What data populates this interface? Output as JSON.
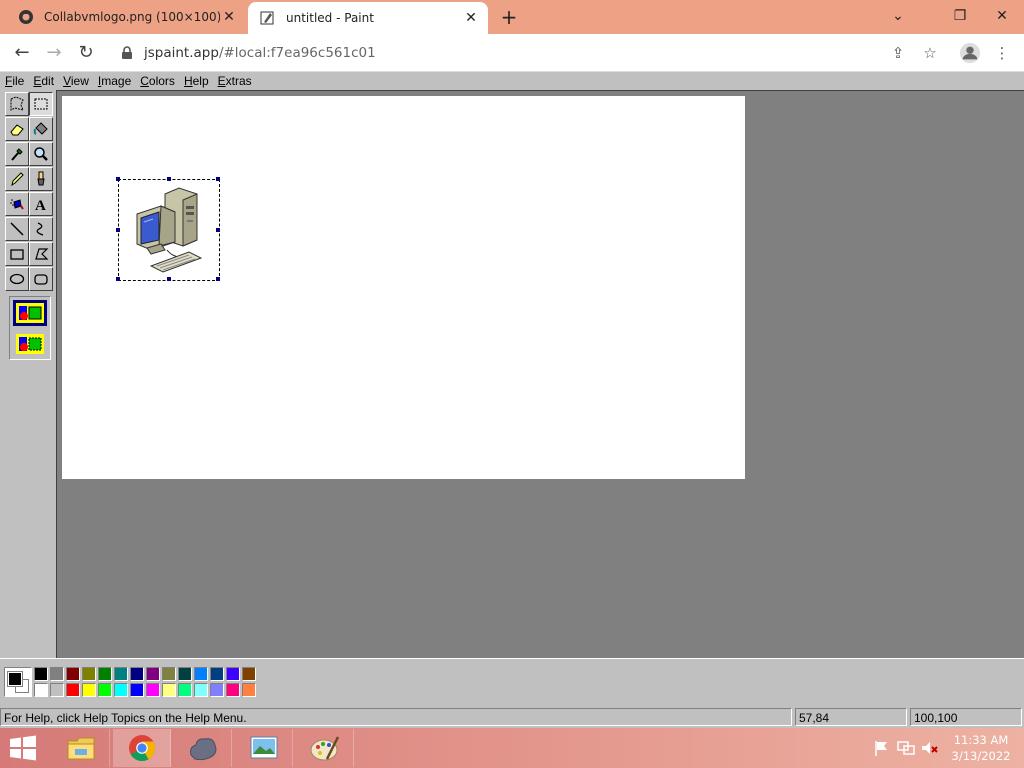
{
  "browser": {
    "tabs": [
      {
        "title": "Collabvmlogo.png (100×100)",
        "icon": "image-tab-icon",
        "active": false
      },
      {
        "title": "untitled - Paint",
        "icon": "paint-tab-icon",
        "active": true
      }
    ],
    "address": {
      "domain": "jspaint.app",
      "path": "/#local:f7ea96c561c01"
    }
  },
  "paint": {
    "menus": [
      {
        "label": "File",
        "accel": "F",
        "rest": "ile"
      },
      {
        "label": "Edit",
        "accel": "E",
        "rest": "dit"
      },
      {
        "label": "View",
        "accel": "V",
        "rest": "iew"
      },
      {
        "label": "Image",
        "accel": "I",
        "rest": "mage"
      },
      {
        "label": "Colors",
        "accel": "C",
        "rest": "olors"
      },
      {
        "label": "Help",
        "accel": "H",
        "rest": "elp"
      },
      {
        "label": "Extras",
        "accel": "E",
        "rest": "xtras"
      }
    ],
    "tools": [
      "free-form-select-icon",
      "select-icon",
      "eraser-icon",
      "fill-bucket-icon",
      "pick-color-icon",
      "magnifier-icon",
      "pencil-icon",
      "brush-icon",
      "airbrush-icon",
      "text-icon",
      "line-icon",
      "curve-icon",
      "rectangle-icon",
      "polygon-icon",
      "ellipse-icon",
      "rounded-rectangle-icon"
    ],
    "selected_tool": "select-icon",
    "palette": {
      "primary": "#000000",
      "secondary": "#ffffff",
      "row1": [
        "#000000",
        "#808080",
        "#800000",
        "#808000",
        "#008000",
        "#008080",
        "#000080",
        "#800080",
        "#808040",
        "#004040",
        "#0080ff",
        "#004080",
        "#4000ff",
        "#804000"
      ],
      "row2": [
        "#ffffff",
        "#c0c0c0",
        "#ff0000",
        "#ffff00",
        "#00ff00",
        "#00ffff",
        "#0000ff",
        "#ff00ff",
        "#ffff80",
        "#00ff80",
        "#80ffff",
        "#8080ff",
        "#ff0080",
        "#ff8040"
      ]
    },
    "status": {
      "help": "For Help, click Help Topics on the Help Menu.",
      "position": "57,84",
      "size": "100,100"
    }
  },
  "taskbar": {
    "apps": [
      "file-explorer-icon",
      "chrome-icon",
      "app-blob-icon",
      "photo-viewer-icon",
      "paint-icon"
    ],
    "active_app": "chrome-icon",
    "time": "11:33 AM",
    "date": "3/13/2022"
  }
}
